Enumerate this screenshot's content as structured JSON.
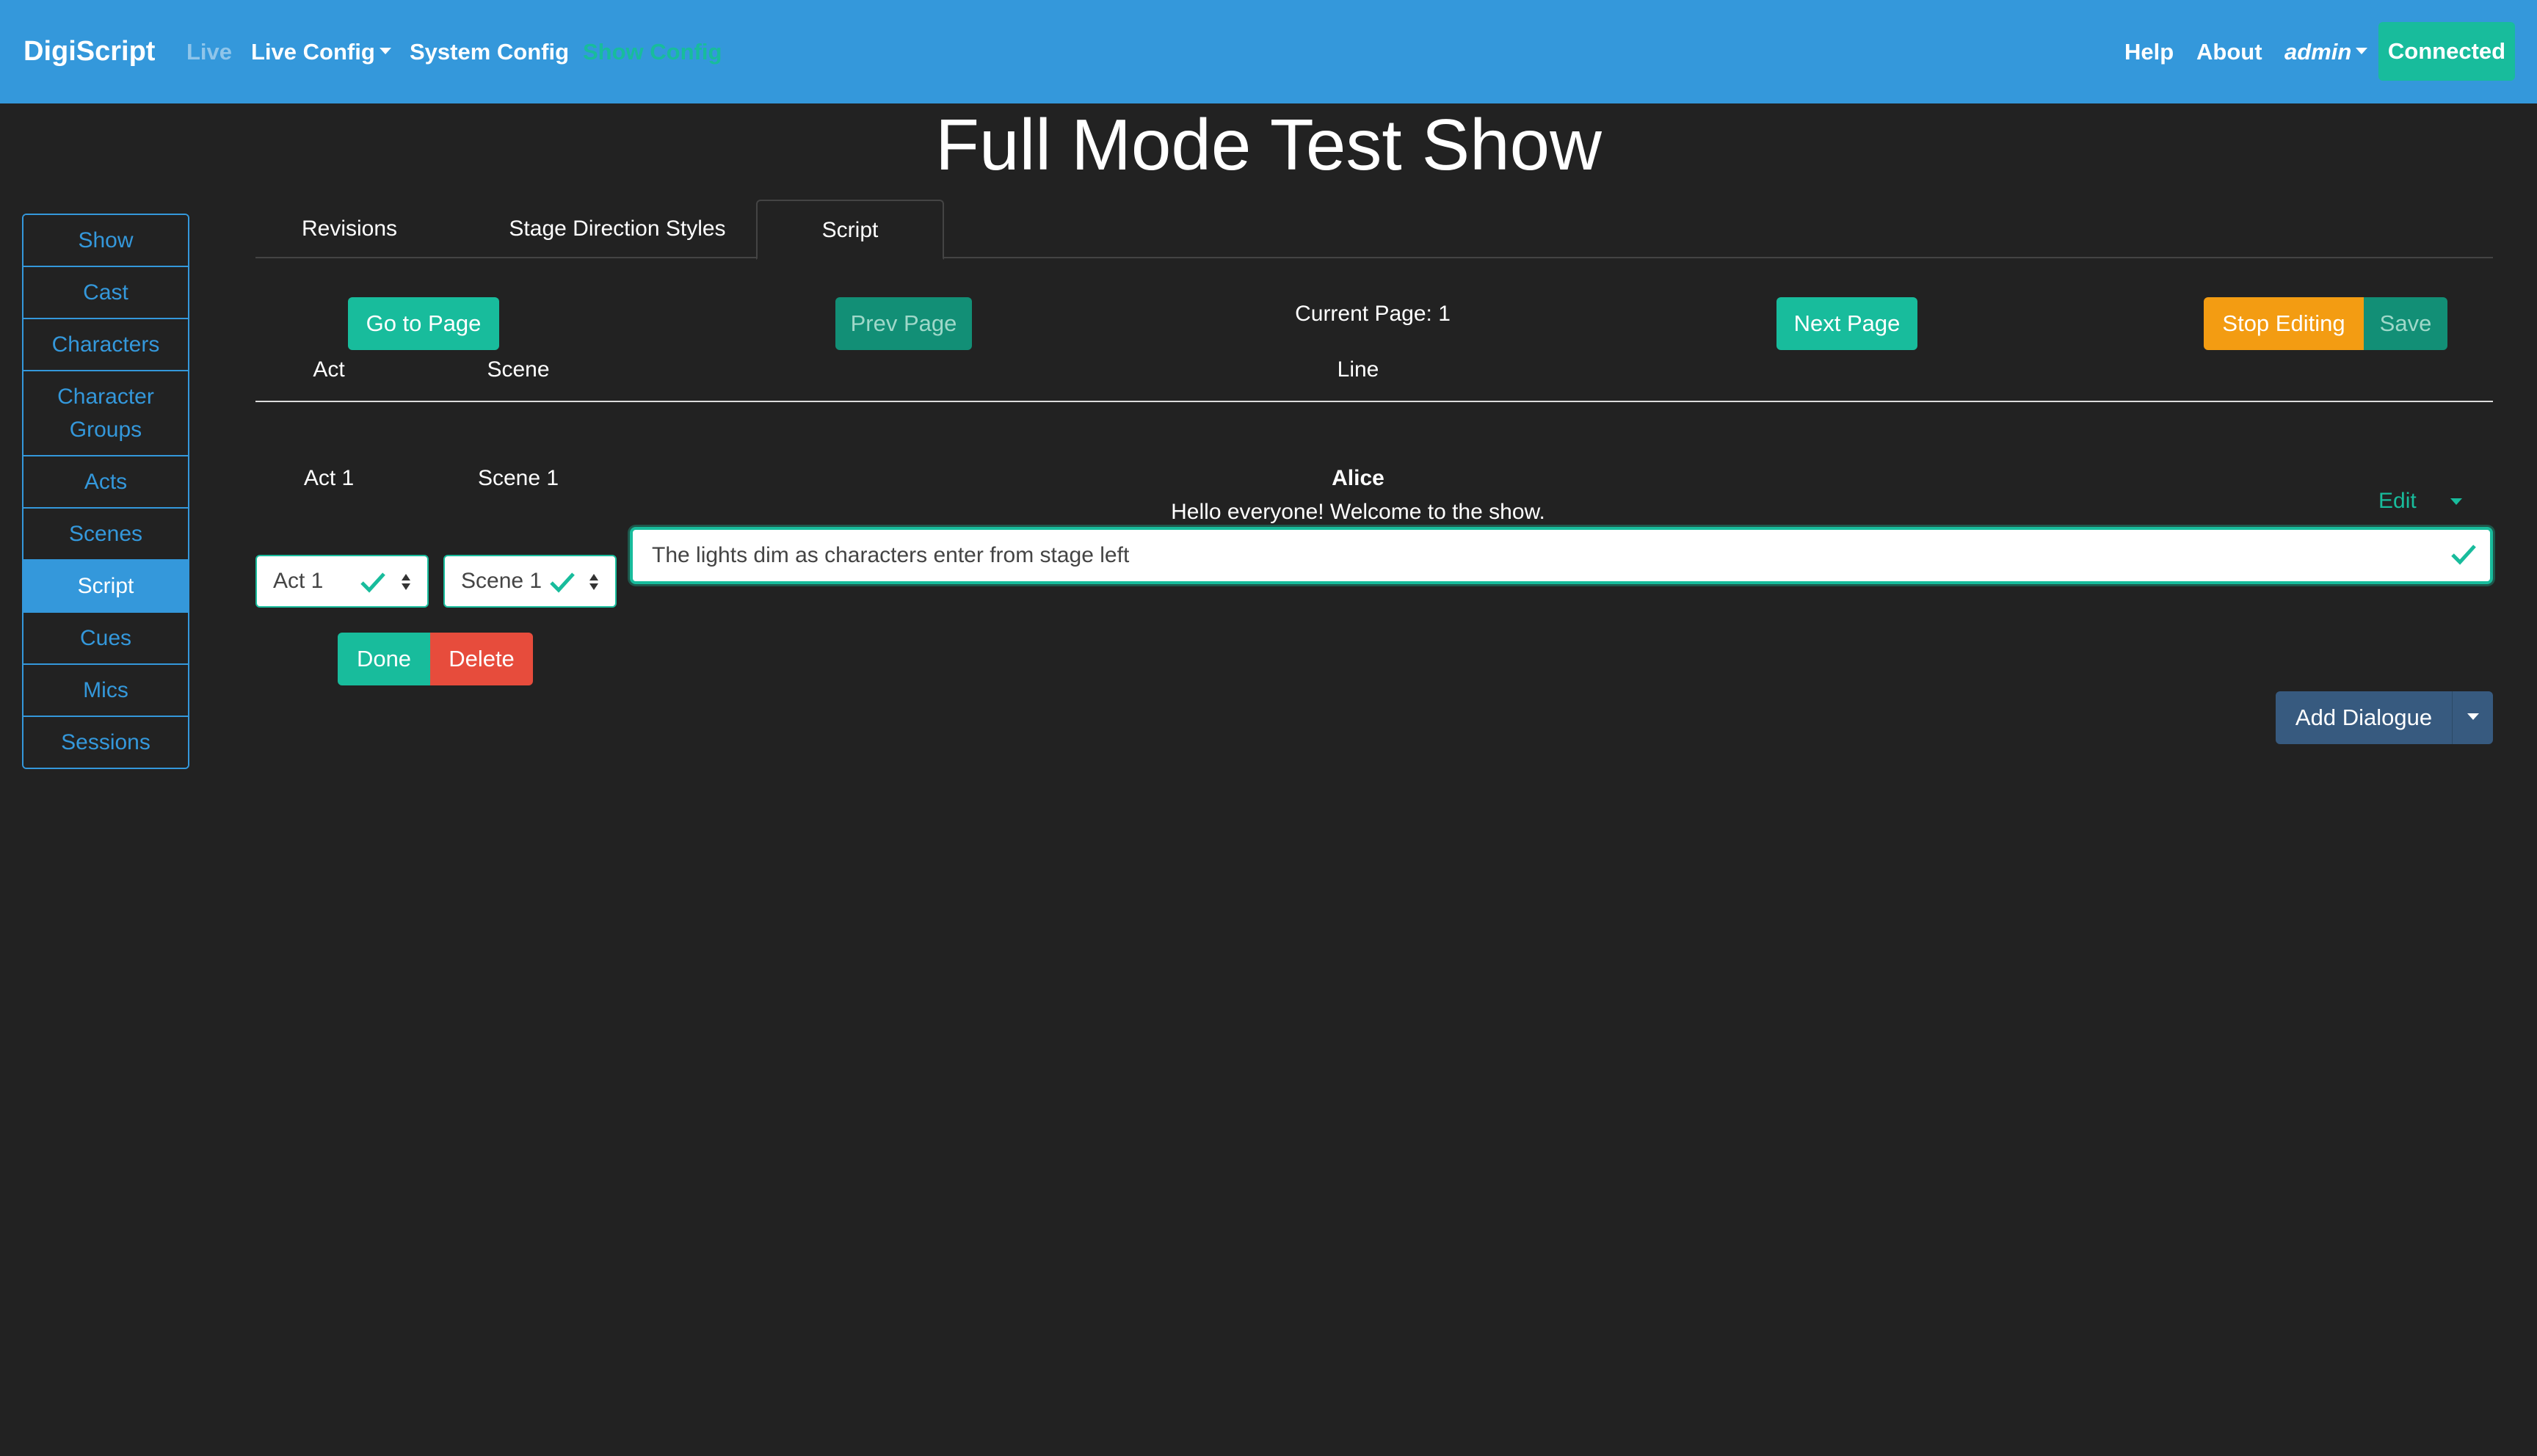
{
  "navbar": {
    "brand": "DigiScript",
    "live": "Live",
    "live_config": "Live Config",
    "system_config": "System Config",
    "show_config": "Show Config",
    "help": "Help",
    "about": "About",
    "user": "admin",
    "status": "Connected"
  },
  "page": {
    "title": "Full Mode Test Show"
  },
  "sidebar": {
    "items": [
      {
        "label": "Show"
      },
      {
        "label": "Cast"
      },
      {
        "label": "Characters"
      },
      {
        "label": "Character Groups"
      },
      {
        "label": "Acts"
      },
      {
        "label": "Scenes"
      },
      {
        "label": "Script"
      },
      {
        "label": "Cues"
      },
      {
        "label": "Mics"
      },
      {
        "label": "Sessions"
      }
    ],
    "active": "Script"
  },
  "tabs": {
    "revisions": "Revisions",
    "stage_direction_styles": "Stage Direction Styles",
    "script": "Script"
  },
  "toolbar": {
    "go_to_page": "Go to Page",
    "prev_page": "Prev Page",
    "current_page": "Current Page: 1",
    "next_page": "Next Page",
    "stop_editing": "Stop Editing",
    "save": "Save"
  },
  "table": {
    "headers": {
      "act": "Act",
      "scene": "Scene",
      "line": "Line"
    },
    "row": {
      "act": "Act 1",
      "scene": "Scene 1",
      "character": "Alice",
      "text": "Hello everyone! Welcome to the show.",
      "edit": "Edit"
    }
  },
  "editor": {
    "act_value": "Act 1",
    "scene_value": "Scene 1",
    "line_value": "The lights dim as characters enter from stage left",
    "done": "Done",
    "delete": "Delete",
    "add_dialogue": "Add Dialogue"
  },
  "colors": {
    "navbar": "#3498db",
    "success": "#18bc9c",
    "warning": "#f39c12",
    "danger": "#e74c3c",
    "primary_dark": "#375a7f",
    "background": "#222222"
  },
  "icons": {
    "check": "check-icon",
    "caret": "caret-down-icon",
    "updown": "sort-updown-icon"
  }
}
